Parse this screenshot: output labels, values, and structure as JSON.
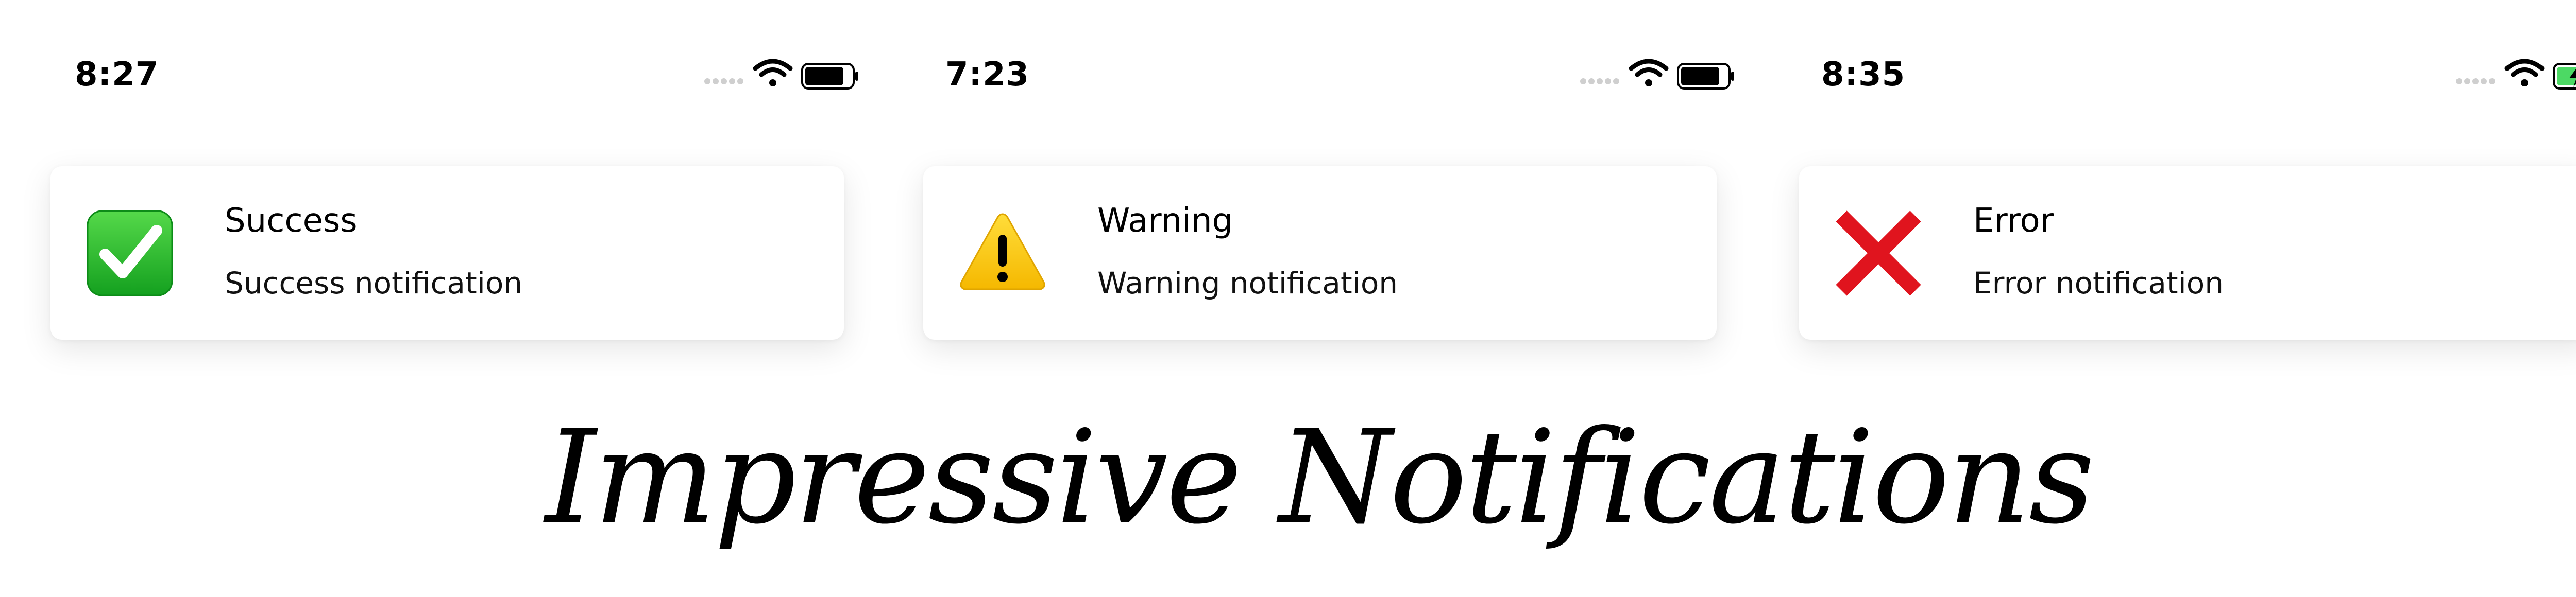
{
  "screens": [
    {
      "status_bar": {
        "time": "8:27",
        "battery": "normal"
      },
      "notification": {
        "title": "Success",
        "message": "Success notification",
        "icon": "check-mark-icon",
        "accent": "#1fb523"
      }
    },
    {
      "status_bar": {
        "time": "7:23",
        "battery": "normal"
      },
      "notification": {
        "title": "Warning",
        "message": "Warning notification",
        "icon": "warning-icon",
        "accent": "#ffc60b"
      }
    },
    {
      "status_bar": {
        "time": "8:35",
        "battery": "charging"
      },
      "notification": {
        "title": "Error",
        "message": "Error notification",
        "icon": "cross-mark-icon",
        "accent": "#e0141e"
      }
    }
  ],
  "headline": "Impressive Notifications"
}
